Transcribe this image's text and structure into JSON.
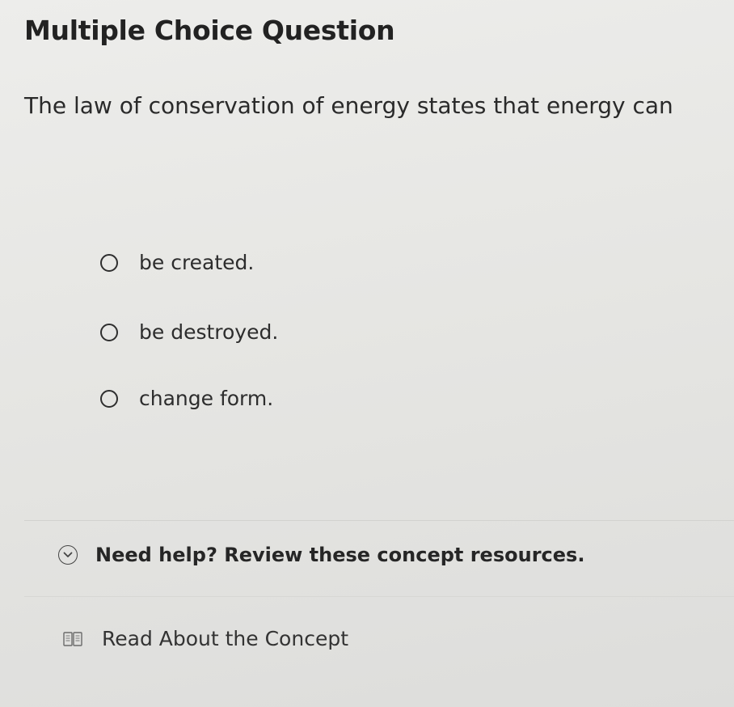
{
  "question": {
    "title": "Multiple Choice Question",
    "prompt": "The law of conservation of energy states that energy can",
    "options": [
      {
        "label": "be created."
      },
      {
        "label": "be destroyed."
      },
      {
        "label": "change form."
      }
    ]
  },
  "help": {
    "label": "Need help? Review these concept resources.",
    "icon": "chevron-down-circle-icon"
  },
  "resources": [
    {
      "label": "Read About the Concept",
      "icon": "book-icon"
    }
  ],
  "colors": {
    "background": "#e8e8e6",
    "text": "#2b2b2b"
  }
}
